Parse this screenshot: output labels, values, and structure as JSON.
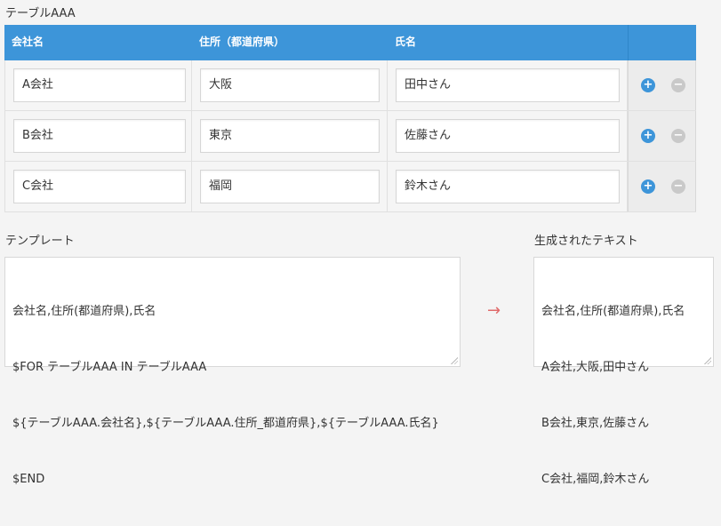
{
  "table": {
    "title": "テーブルAAA",
    "headers": [
      "会社名",
      "住所（都道府県）",
      "氏名"
    ],
    "rows": [
      {
        "company": "A会社",
        "address": "大阪",
        "name": "田中さん"
      },
      {
        "company": "B会社",
        "address": "東京",
        "name": "佐藤さん"
      },
      {
        "company": "C会社",
        "address": "福岡",
        "name": "鈴木さん"
      }
    ],
    "add_symbol": "+",
    "remove_symbol": "−"
  },
  "template": {
    "label": "テンプレート",
    "lines": [
      "会社名,住所(都道府県),氏名",
      "$FOR テーブルAAA IN テーブルAAA",
      "${テーブルAAA.会社名},${テーブルAAA.住所_都道府県},${テーブルAAA.氏名}",
      "$END"
    ]
  },
  "arrow": "→",
  "output": {
    "label": "生成されたテキスト",
    "lines": [
      "会社名,住所(都道府県),氏名",
      "A会社,大阪,田中さん",
      "B会社,東京,佐藤さん",
      "C会社,福岡,鈴木さん"
    ]
  },
  "colors": {
    "header_bg": "#3d95d9",
    "add_button": "#3d95d9",
    "remove_button": "#c9c9c9",
    "arrow": "#e06a6a"
  }
}
